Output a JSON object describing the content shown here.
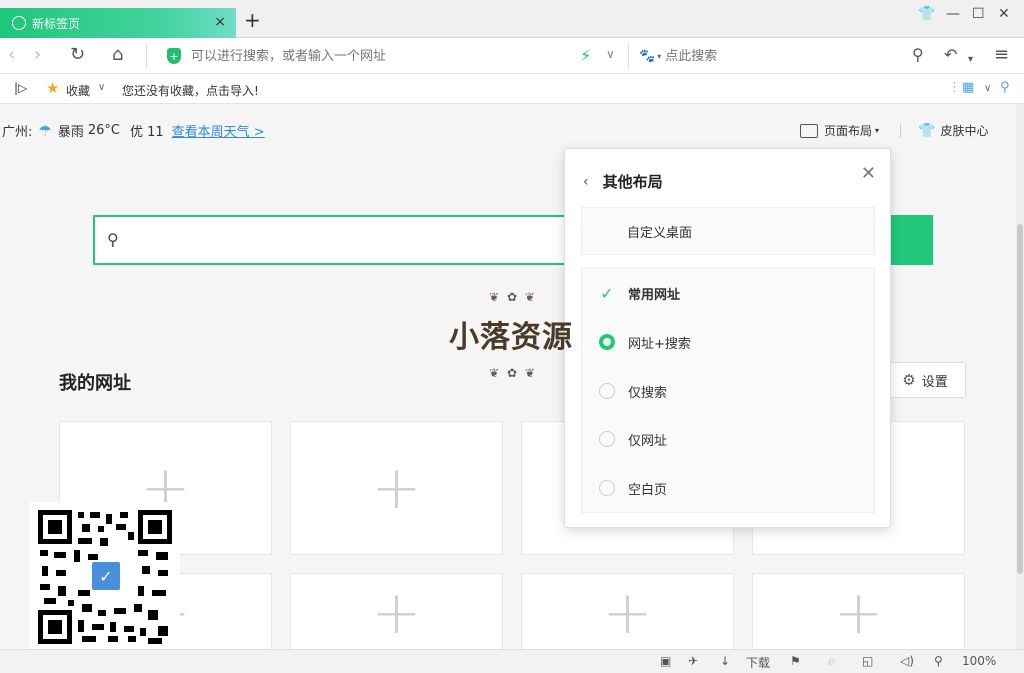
{
  "tab": {
    "title": "新标签页",
    "close": "×"
  },
  "newtab": "+",
  "address": {
    "placeholder": "可以进行搜索，或者输入一个网址"
  },
  "search": {
    "placeholder": "点此搜索",
    "engine_icon": "baidu-paw-icon"
  },
  "bookmarks": {
    "favorites_label": "收藏",
    "empty_text": "您还没有收藏，点击导入!"
  },
  "weather": {
    "city": "广州:",
    "condition": "暴雨",
    "temp": "26°C",
    "aqi": "优 11",
    "link": "查看本周天气 >"
  },
  "topbar": {
    "layout_label": "页面布局",
    "skin_label": "皮肤中心"
  },
  "main": {
    "mysites_title": "我的网址",
    "settings_label": "设置"
  },
  "popup": {
    "title": "其他布局",
    "custom_label": "自定义桌面",
    "options": [
      {
        "label": "常用网址",
        "state": "checked"
      },
      {
        "label": "网址+搜索",
        "state": "selected"
      },
      {
        "label": "仅搜索",
        "state": "off"
      },
      {
        "label": "仅网址",
        "state": "off"
      },
      {
        "label": "空白页",
        "state": "off"
      }
    ]
  },
  "watermark": {
    "text": "小落资源"
  },
  "status": {
    "download_label": "下载",
    "zoom": "100%"
  },
  "colors": {
    "accent": "#22c77a",
    "link": "#2e8ade",
    "tab_gradient_start": "#1fc67a"
  }
}
